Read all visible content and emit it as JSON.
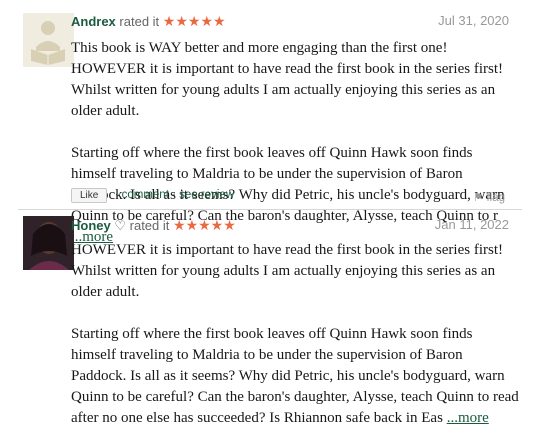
{
  "reviews": [
    {
      "user": "Andrex",
      "rated_text": "rated it",
      "stars": "★★★★★",
      "date": "Jul 31, 2020",
      "paragraphs": [
        "This book is WAY better and more engaging than the first one! HOWEVER it is important to have read the first book in the series first! Whilst written for young adults I am actually enjoying this series as an older adult.",
        "Starting off where the first book leaves off Quinn Hawk soon finds himself traveling to Maldria to be under the supervision of Baron Paddock. Is all as it seems? Why did Petric, his uncle's bodyguard, warn Quinn to be careful? Can the baron's daughter, Alysse, teach Quinn to r"
      ],
      "more": "...more",
      "like": "Like",
      "comment": "comment",
      "see_review": "see review",
      "sep": "·",
      "flag": "flag"
    },
    {
      "user": "Honey",
      "heart": "♡",
      "rated_text": "rated it",
      "stars": "★★★★★",
      "date": "Jan 11, 2022",
      "paragraphs": [
        "HOWEVER it is important to have read the first book in the series first! Whilst written for young adults I am actually enjoying this series as an older adult.",
        "Starting off where the first book leaves off Quinn Hawk soon finds himself traveling to Maldria to be under the supervision of Baron Paddock. Is all as it seems? Why did Petric, his uncle's bodyguard, warn Quinn to be careful? Can the baron's daughter, Alysse, teach Quinn to read after no one else has succeeded? Is Rhiannon safe back in Eas"
      ],
      "more": "...more"
    }
  ]
}
